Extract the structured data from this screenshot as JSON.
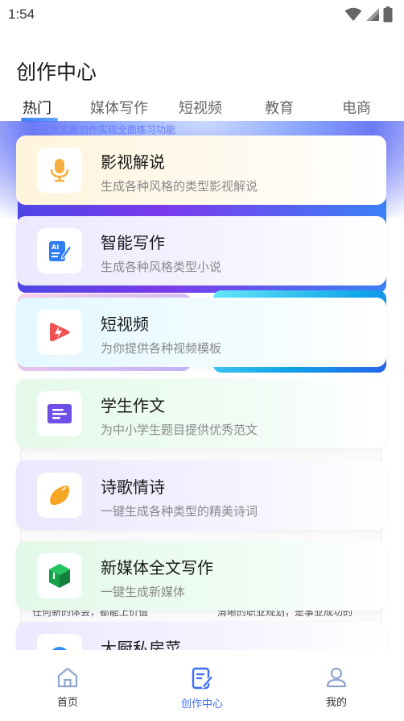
{
  "status_bar": {
    "time": "1:54"
  },
  "header": {
    "title": "创作中心"
  },
  "tabs": [
    {
      "label": "热门",
      "active": true
    },
    {
      "label": "媒体写作",
      "active": false
    },
    {
      "label": "短视频",
      "active": false
    },
    {
      "label": "教育",
      "active": false
    },
    {
      "label": "电商",
      "active": false
    }
  ],
  "background": {
    "banner_text": "文本文案创作实现全面练习功能",
    "left_text": "任何新的体会，都能上价值",
    "right_text": "清晰的职业规划，是事业成功的"
  },
  "cards": [
    {
      "title": "影视解说",
      "desc": "生成各种风格的类型影视解说",
      "icon": "microphone-icon"
    },
    {
      "title": "智能写作",
      "desc": "生成各种风格类型小说",
      "icon": "ai-writing-icon"
    },
    {
      "title": "短视频",
      "desc": "为你提供各种视频模板",
      "icon": "video-bolt-icon"
    },
    {
      "title": "学生作文",
      "desc": "为中小学生题目提供优秀范文",
      "icon": "essay-icon"
    },
    {
      "title": "诗歌情诗",
      "desc": "一键生成各种类型的精美诗词",
      "icon": "leaf-icon"
    },
    {
      "title": "新媒体全文写作",
      "desc": "一键生成新媒体",
      "icon": "cube-icon"
    },
    {
      "title": "大厨私房菜",
      "desc": "",
      "icon": "chef-icon"
    }
  ],
  "bottom_nav": [
    {
      "label": "首页",
      "icon": "home-icon",
      "active": false
    },
    {
      "label": "创作中心",
      "icon": "create-icon",
      "active": true
    },
    {
      "label": "我的",
      "icon": "profile-icon",
      "active": false
    }
  ],
  "colors": {
    "accent": "#3b6cf6",
    "card1_bg": "#fff7e6",
    "card2_bg": "#f1efff",
    "card3_bg": "#ecfbff",
    "card4_bg": "#ebfbf0",
    "card5_bg": "#efecff",
    "card6_bg": "#eafbef"
  }
}
